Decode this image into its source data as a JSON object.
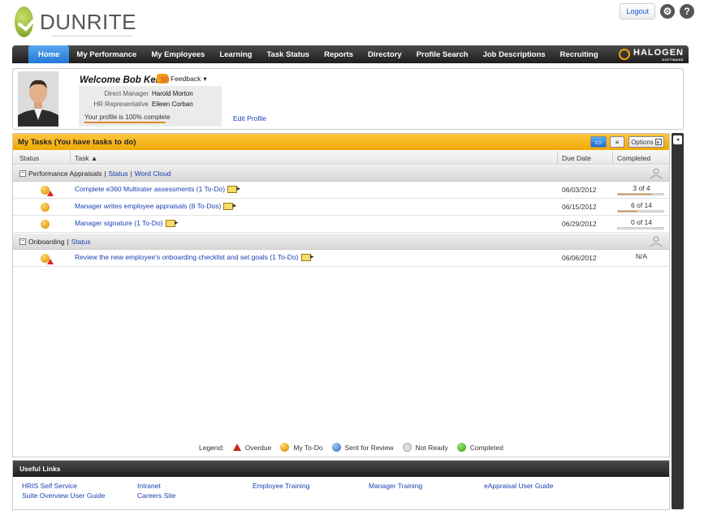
{
  "brand": {
    "name": "DUNRITE",
    "vendor": "HALOGEN",
    "vendor_sub": "SOFTWARE"
  },
  "topbar": {
    "logout_label": "Logout",
    "settings_icon": "gear-icon",
    "help_icon": "help-icon",
    "help_glyph": "?"
  },
  "nav": {
    "items": [
      "Home",
      "My Performance",
      "My Employees",
      "Learning",
      "Task Status",
      "Reports",
      "Directory",
      "Profile Search",
      "Job Descriptions",
      "Recruiting"
    ],
    "active": "Home"
  },
  "welcome": {
    "title": "Welcome Bob Keith",
    "feedback_label": "Feedback",
    "manager_label": "Direct Manager",
    "manager_name": "Harold Morton",
    "hr_label": "HR Representative",
    "hr_name": "Eileen Corban",
    "profile_status": "Your profile is 100% complete",
    "profile_complete": 1.0,
    "edit_profile": "Edit Profile"
  },
  "tasks": {
    "title": "My Tasks (You have tasks to do)",
    "options_label": "Options",
    "columns": {
      "status": "Status",
      "task": "Task ▲",
      "due": "Due Date",
      "completed": "Completed"
    },
    "groups": [
      {
        "name": "Performance Appraisals",
        "links": [
          "Status",
          "Word Cloud"
        ],
        "rows": [
          {
            "task": "Complete e360 Multirater assessments (1 To-Do)",
            "due": "06/03/2012",
            "completed": "3 of 4",
            "progress": 0.75,
            "overdue": true
          },
          {
            "task": "Manager writes employee appraisals (8 To-Dos)",
            "due": "06/15/2012",
            "completed": "6 of 14",
            "progress": 0.43,
            "overdue": false
          },
          {
            "task": "Manager signature (1 To-Do)",
            "due": "06/29/2012",
            "completed": "0 of 14",
            "progress": 0.0,
            "overdue": false
          }
        ]
      },
      {
        "name": "Onboarding",
        "links": [
          "Status"
        ],
        "rows": [
          {
            "task": "Review the new employee's onboarding checklist and set goals (1 To-Do)",
            "due": "06/06/2012",
            "completed": "N/A",
            "overdue": true
          }
        ]
      }
    ]
  },
  "legend": {
    "label": "Legend:",
    "items": [
      "Overdue",
      "My To-Do",
      "Sent for Review",
      "Not Ready",
      "Completed"
    ]
  },
  "useful_links": {
    "title": "Useful Links",
    "links": [
      "HRIS Self Service",
      "Suite Overview User Guide",
      "Intranet",
      "Careers Site",
      "Employee Training",
      "Manager Training",
      "eAppraisal User Guide"
    ]
  }
}
